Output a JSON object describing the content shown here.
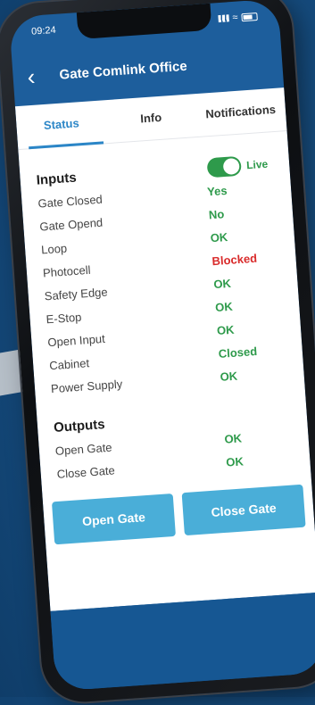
{
  "status_bar": {
    "time": "09:24"
  },
  "header": {
    "back_glyph": "‹",
    "title": "Gate Comlink Office"
  },
  "tabs": [
    {
      "label": "Status",
      "active": true
    },
    {
      "label": "Info",
      "active": false
    },
    {
      "label": "Notifications",
      "active": false
    }
  ],
  "inputs": {
    "title": "Inputs",
    "live_label": "Live",
    "live_on": true,
    "rows": [
      {
        "label": "Gate Closed",
        "value": "Yes"
      },
      {
        "label": "Gate Opend",
        "value": "No"
      },
      {
        "label": "Loop",
        "value": "OK"
      },
      {
        "label": "Photocell",
        "value": "Blocked"
      },
      {
        "label": "Safety Edge",
        "value": "OK"
      },
      {
        "label": "E-Stop",
        "value": "OK"
      },
      {
        "label": "Open Input",
        "value": "OK"
      },
      {
        "label": "Cabinet",
        "value": "Closed"
      },
      {
        "label": "Power Supply",
        "value": "OK"
      }
    ]
  },
  "outputs": {
    "title": "Outputs",
    "rows": [
      {
        "label": "Open Gate",
        "value": "OK"
      },
      {
        "label": "Close Gate",
        "value": "OK"
      }
    ]
  },
  "buttons": {
    "open_gate": "Open Gate",
    "close_gate": "Close Gate"
  },
  "colors": {
    "ok": "#2e9a4b",
    "blocked": "#d92b2b",
    "accent": "#2b86c7",
    "button": "#4aaed8",
    "header_bg": "#1d5e9c"
  }
}
